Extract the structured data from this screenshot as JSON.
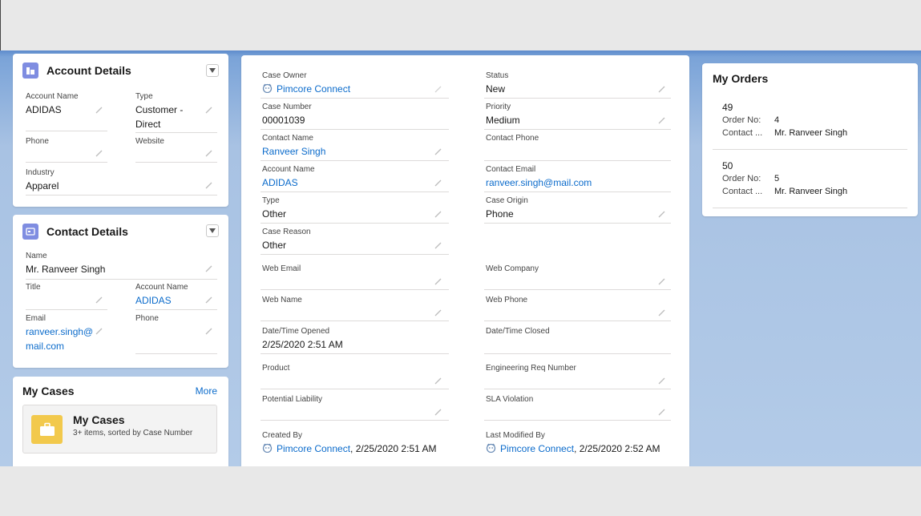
{
  "account_details": {
    "title": "Account Details",
    "account_name_label": "Account Name",
    "account_name": "ADIDAS",
    "type_label": "Type",
    "type_line1": "Customer -",
    "type_line2": "Direct",
    "phone_label": "Phone",
    "website_label": "Website",
    "industry_label": "Industry",
    "industry": "Apparel"
  },
  "contact_details": {
    "title": "Contact Details",
    "name_label": "Name",
    "name": "Mr. Ranveer Singh",
    "title_label": "Title",
    "account_name_label": "Account Name",
    "account_name": "ADIDAS",
    "email_label": "Email",
    "email_line1": "ranveer.singh@",
    "email_line2": "mail.com",
    "phone_label": "Phone"
  },
  "my_cases": {
    "title": "My Cases",
    "more": "More",
    "list_title": "My Cases",
    "list_sub": "3+ items, sorted by Case Number"
  },
  "case": {
    "case_owner_label": "Case Owner",
    "case_owner": "Pimcore Connect",
    "status_label": "Status",
    "status": "New",
    "case_number_label": "Case Number",
    "case_number": "00001039",
    "priority_label": "Priority",
    "priority": "Medium",
    "contact_name_label": "Contact Name",
    "contact_name": "Ranveer Singh",
    "contact_phone_label": "Contact Phone",
    "account_name_label": "Account Name",
    "account_name": "ADIDAS",
    "contact_email_label": "Contact Email",
    "contact_email": "ranveer.singh@mail.com",
    "type_label": "Type",
    "type": "Other",
    "case_origin_label": "Case Origin",
    "case_origin": "Phone",
    "case_reason_label": "Case Reason",
    "case_reason": "Other",
    "web_email_label": "Web Email",
    "web_company_label": "Web Company",
    "web_name_label": "Web Name",
    "web_phone_label": "Web Phone",
    "opened_label": "Date/Time Opened",
    "opened": "2/25/2020 2:51 AM",
    "closed_label": "Date/Time Closed",
    "product_label": "Product",
    "engineering_label": "Engineering Req Number",
    "liability_label": "Potential Liability",
    "sla_label": "SLA Violation",
    "created_by_label": "Created By",
    "created_by_user": "Pimcore Connect",
    "created_by_date": ", 2/25/2020 2:51 AM",
    "modified_by_label": "Last Modified By",
    "modified_by_user": "Pimcore Connect",
    "modified_by_date": ", 2/25/2020 2:52 AM"
  },
  "my_orders": {
    "title": "My Orders",
    "orders": [
      {
        "id": "49",
        "order_no_label": "Order No:",
        "order_no": "4",
        "contact_label": "Contact ...",
        "contact": "Mr. Ranveer Singh"
      },
      {
        "id": "50",
        "order_no_label": "Order No:",
        "order_no": "5",
        "contact_label": "Contact ...",
        "contact": "Mr. Ranveer Singh"
      }
    ]
  },
  "colors": {
    "accent": "#0b6bcb",
    "icon_purple": "#7f8de1",
    "cases_yellow": "#f2c94c"
  },
  "icons": [
    "account-icon",
    "contact-card-icon",
    "case-briefcase-icon",
    "pencil-icon",
    "chevron-down-icon",
    "user-avatar-icon"
  ]
}
